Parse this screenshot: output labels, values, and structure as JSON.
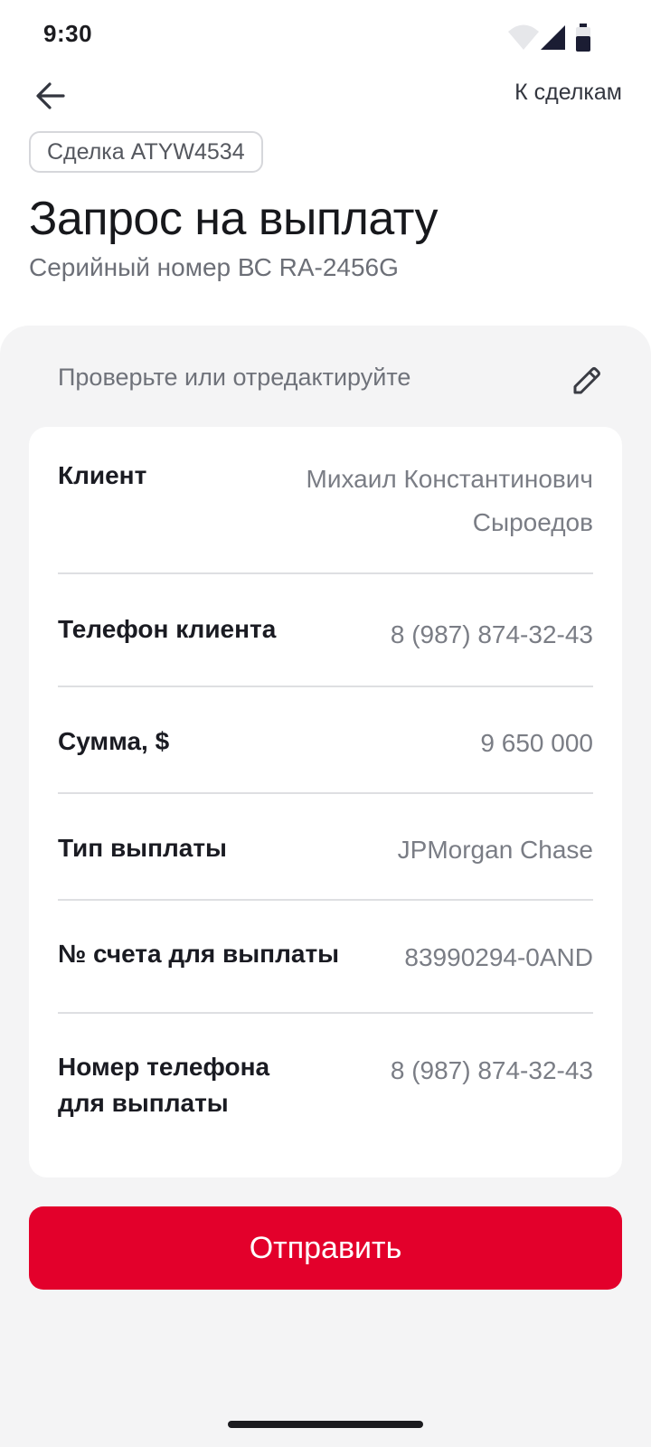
{
  "status_bar": {
    "time": "9:30",
    "icons": [
      "wifi-icon",
      "signal-icon",
      "battery-icon"
    ]
  },
  "nav": {
    "back_icon": "arrow-left-icon",
    "to_deals_label": "К сделкам"
  },
  "deal": {
    "chip_label": "Сделка ATYW4534"
  },
  "header": {
    "title": "Запрос на выплату",
    "subtitle": "Серийный номер ВС RA-2456G"
  },
  "review": {
    "hint": "Проверьте или отредактируйте",
    "edit_icon": "pencil-icon"
  },
  "details": {
    "client_label": "Клиент",
    "client_value_line1": "Михаил Константинович",
    "client_value_line2": "Сыроедов",
    "client_phone_label": "Телефон клиента",
    "client_phone_value": "8 (987) 874-32-43",
    "amount_label": "Сумма, $",
    "amount_value": "9 650 000",
    "payout_type_label": "Тип выплаты",
    "payout_type_value": "JPMorgan Chase",
    "account_label": "№ счета для выплаты",
    "account_value": "83990294-0AND",
    "payout_phone_label_line1": "Номер телефона",
    "payout_phone_label_line2": "для выплаты",
    "payout_phone_value": "8 (987) 874-32-43"
  },
  "actions": {
    "submit_label": "Отправить"
  },
  "colors": {
    "accent": "#e3002b",
    "sheet_bg": "#f4f4f5",
    "card_bg": "#ffffff"
  }
}
